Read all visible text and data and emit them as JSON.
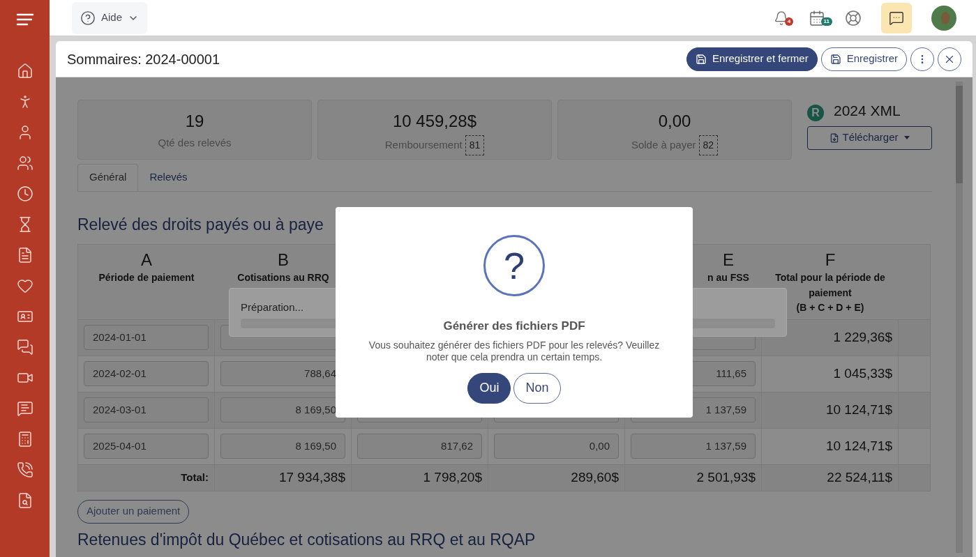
{
  "top_bar": {
    "help": {
      "label": "Aide"
    },
    "notifications": {
      "badge": "4"
    },
    "calendar": {
      "badge": "11"
    },
    "chat": {
      "selected": true
    }
  },
  "document": {
    "title": "Sommaires: 2024-00001",
    "buttons": [
      {
        "label": "Enregistrer et fermer",
        "kind": "primary"
      },
      {
        "label": "Enregistrer",
        "kind": "outline"
      }
    ]
  },
  "stats": [
    {
      "value": "19",
      "label": "Qté des relevés"
    },
    {
      "value": "10 459,28$",
      "label": "Remboursement",
      "code": "81"
    },
    {
      "value": "0,00",
      "label": "Solde à payer",
      "code": "82"
    }
  ],
  "xml": {
    "badge": "R",
    "title": "2024 XML",
    "download": "Télécharger"
  },
  "tabs": [
    {
      "label": "Général",
      "selected": true
    },
    {
      "label": "Relevés",
      "selected": false
    }
  ],
  "section_title": "Relevé des droits payés ou à paye",
  "table": {
    "columns": [
      {
        "letter": "A",
        "label": "Période de paiement"
      },
      {
        "letter": "B",
        "label": "Cotisations au RRQ"
      },
      null,
      null,
      {
        "letter": "E",
        "label": "n au FSS"
      },
      {
        "letter": "F",
        "label": "Total pour la période de paiement",
        "note": "(B + C + D + E)"
      }
    ],
    "rows": [
      {
        "period": "2024-01-01",
        "values": {},
        "total": "1 229,36$"
      },
      {
        "period": "2024-02-01",
        "values": {
          "b": "788,64",
          "e": "111,65"
        },
        "total": "1 045,33$"
      },
      {
        "period": "2024-03-01",
        "values": {
          "b": "8 169,50",
          "e": "1 137,59"
        },
        "total": "10 124,71$"
      },
      {
        "period": "2025-04-01",
        "values": {
          "b": "8 169,50",
          "c": "817,62",
          "d": "0,00",
          "e": "1 137,59"
        },
        "total": "10 124,71$"
      }
    ],
    "totals": {
      "label": "Total:",
      "values": [
        "17 934,38$",
        "1 798,20$",
        "289,60$",
        "2 501,93$",
        "22 524,11$"
      ]
    }
  },
  "add_payment": "Ajouter un paiement",
  "next_section_title": "Retenues d'impôt du Québec et cotisations au RRQ et au RQAP",
  "progress": {
    "text": "Préparation..."
  },
  "modal": {
    "icon": "?",
    "title": "Générer des fichiers PDF",
    "message": "Vous souhaitez générer des fichiers PDF pour les relevés? Veuillez noter que cela prendra un certain temps.",
    "buttons": [
      {
        "label": "Oui",
        "kind": "primary"
      },
      {
        "label": "Non",
        "kind": "outline"
      }
    ]
  }
}
